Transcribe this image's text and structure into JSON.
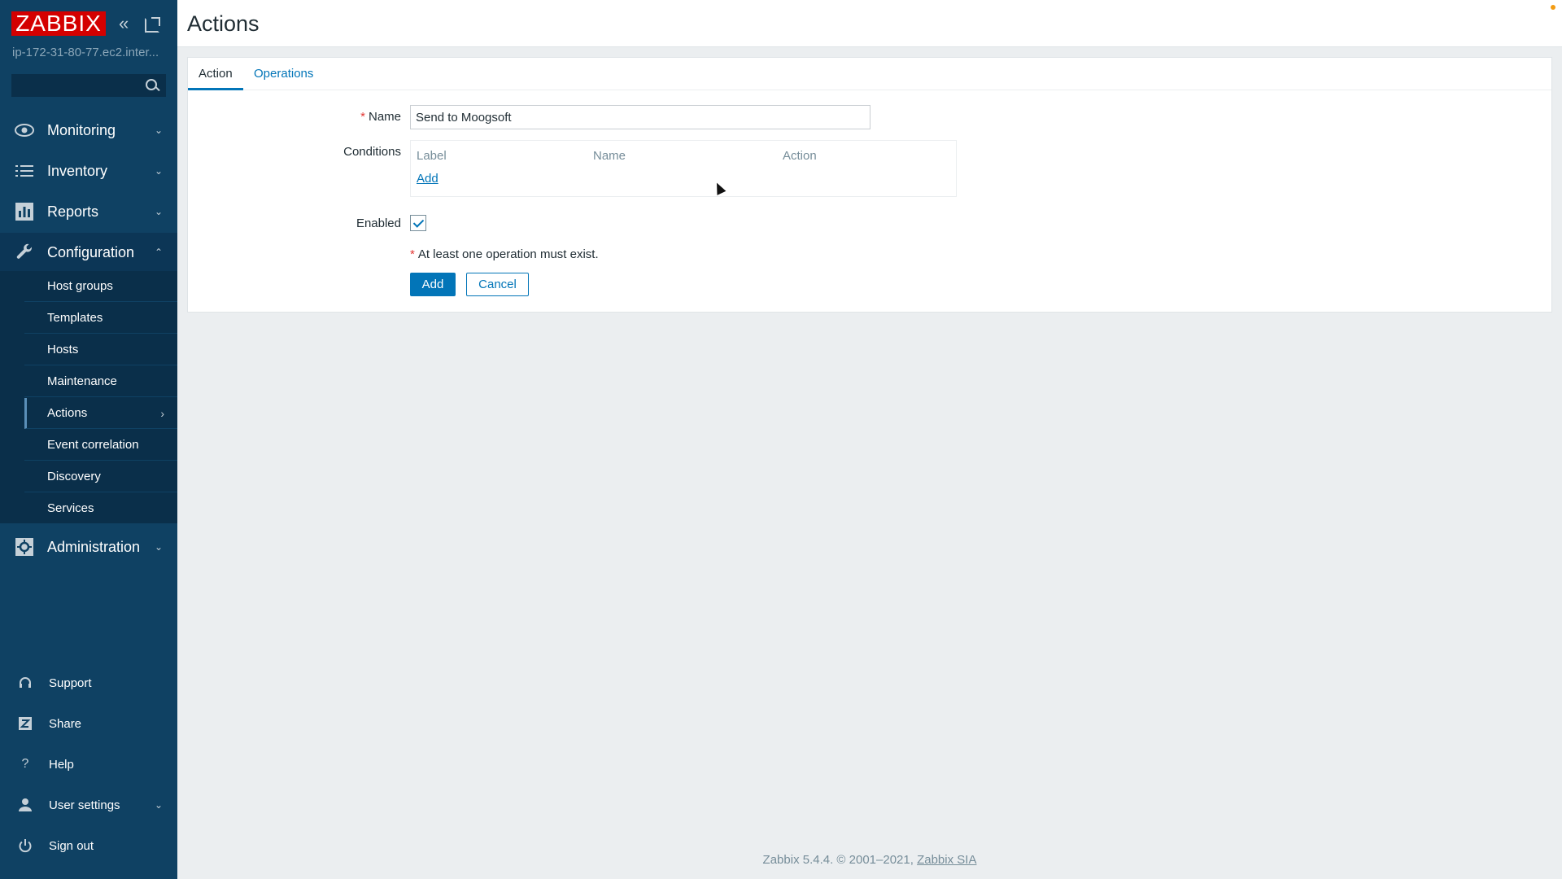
{
  "app": {
    "logo": "ZABBIX",
    "server": "ip-172-31-80-77.ec2.inter...",
    "search_placeholder": ""
  },
  "nav": {
    "main": [
      {
        "label": "Monitoring",
        "icon": "eye-icon"
      },
      {
        "label": "Inventory",
        "icon": "list-icon"
      },
      {
        "label": "Reports",
        "icon": "bar-chart-icon"
      },
      {
        "label": "Configuration",
        "icon": "wrench-icon"
      },
      {
        "label": "Administration",
        "icon": "gear-icon"
      }
    ],
    "configuration_items": [
      {
        "label": "Host groups"
      },
      {
        "label": "Templates"
      },
      {
        "label": "Hosts"
      },
      {
        "label": "Maintenance"
      },
      {
        "label": "Actions"
      },
      {
        "label": "Event correlation"
      },
      {
        "label": "Discovery"
      },
      {
        "label": "Services"
      }
    ],
    "bottom": [
      {
        "label": "Support",
        "icon": "headset-icon"
      },
      {
        "label": "Share",
        "icon": "share-icon"
      },
      {
        "label": "Help",
        "icon": "help-icon"
      },
      {
        "label": "User settings",
        "icon": "user-icon"
      },
      {
        "label": "Sign out",
        "icon": "power-icon"
      }
    ]
  },
  "page": {
    "title": "Actions"
  },
  "tabs": [
    {
      "label": "Action"
    },
    {
      "label": "Operations"
    }
  ],
  "form": {
    "name_label": "Name",
    "name_value": "Send to Moogsoft",
    "conditions_label": "Conditions",
    "conditions_columns": [
      "Label",
      "Name",
      "Action"
    ],
    "conditions_add": "Add",
    "enabled_label": "Enabled",
    "enabled": true,
    "hint": "At least one operation must exist.",
    "add_button": "Add",
    "cancel_button": "Cancel"
  },
  "footer": {
    "text": "Zabbix 5.4.4. © 2001–2021,",
    "link": "Zabbix SIA"
  },
  "colors": {
    "sidebar": "#0f4163",
    "accent": "#0275b8",
    "logo": "#d40000",
    "required": "#e33734"
  }
}
